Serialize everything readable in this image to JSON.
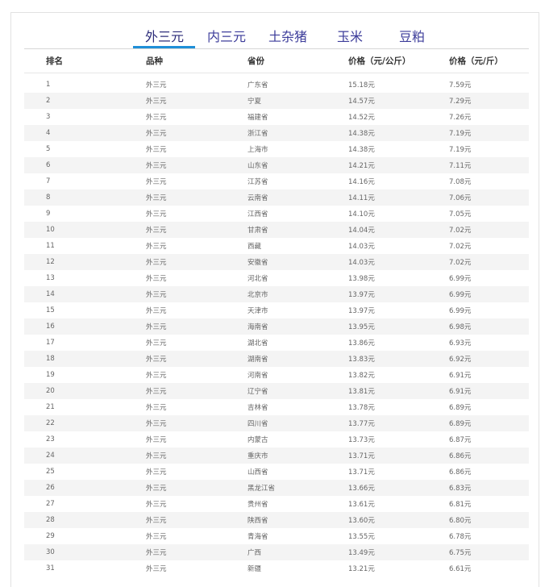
{
  "tabs": [
    {
      "label": "外三元",
      "active": true
    },
    {
      "label": "内三元",
      "active": false
    },
    {
      "label": "土杂猪",
      "active": false
    },
    {
      "label": "玉米",
      "active": false
    },
    {
      "label": "豆粕",
      "active": false
    }
  ],
  "table": {
    "headers": [
      "排名",
      "品种",
      "省份",
      "价格（元/公斤）",
      "价格（元/斤）"
    ],
    "rows": [
      [
        "1",
        "外三元",
        "广东省",
        "15.18元",
        "7.59元"
      ],
      [
        "2",
        "外三元",
        "宁夏",
        "14.57元",
        "7.29元"
      ],
      [
        "3",
        "外三元",
        "福建省",
        "14.52元",
        "7.26元"
      ],
      [
        "4",
        "外三元",
        "浙江省",
        "14.38元",
        "7.19元"
      ],
      [
        "5",
        "外三元",
        "上海市",
        "14.38元",
        "7.19元"
      ],
      [
        "6",
        "外三元",
        "山东省",
        "14.21元",
        "7.11元"
      ],
      [
        "7",
        "外三元",
        "江苏省",
        "14.16元",
        "7.08元"
      ],
      [
        "8",
        "外三元",
        "云南省",
        "14.11元",
        "7.06元"
      ],
      [
        "9",
        "外三元",
        "江西省",
        "14.10元",
        "7.05元"
      ],
      [
        "10",
        "外三元",
        "甘肃省",
        "14.04元",
        "7.02元"
      ],
      [
        "11",
        "外三元",
        "西藏",
        "14.03元",
        "7.02元"
      ],
      [
        "12",
        "外三元",
        "安徽省",
        "14.03元",
        "7.02元"
      ],
      [
        "13",
        "外三元",
        "河北省",
        "13.98元",
        "6.99元"
      ],
      [
        "14",
        "外三元",
        "北京市",
        "13.97元",
        "6.99元"
      ],
      [
        "15",
        "外三元",
        "天津市",
        "13.97元",
        "6.99元"
      ],
      [
        "16",
        "外三元",
        "海南省",
        "13.95元",
        "6.98元"
      ],
      [
        "17",
        "外三元",
        "湖北省",
        "13.86元",
        "6.93元"
      ],
      [
        "18",
        "外三元",
        "湖南省",
        "13.83元",
        "6.92元"
      ],
      [
        "19",
        "外三元",
        "河南省",
        "13.82元",
        "6.91元"
      ],
      [
        "20",
        "外三元",
        "辽宁省",
        "13.81元",
        "6.91元"
      ],
      [
        "21",
        "外三元",
        "吉林省",
        "13.78元",
        "6.89元"
      ],
      [
        "22",
        "外三元",
        "四川省",
        "13.77元",
        "6.89元"
      ],
      [
        "23",
        "外三元",
        "内蒙古",
        "13.73元",
        "6.87元"
      ],
      [
        "24",
        "外三元",
        "重庆市",
        "13.71元",
        "6.86元"
      ],
      [
        "25",
        "外三元",
        "山西省",
        "13.71元",
        "6.86元"
      ],
      [
        "26",
        "外三元",
        "黑龙江省",
        "13.66元",
        "6.83元"
      ],
      [
        "27",
        "外三元",
        "贵州省",
        "13.61元",
        "6.81元"
      ],
      [
        "28",
        "外三元",
        "陕西省",
        "13.60元",
        "6.80元"
      ],
      [
        "29",
        "外三元",
        "青海省",
        "13.55元",
        "6.78元"
      ],
      [
        "30",
        "外三元",
        "广西",
        "13.49元",
        "6.75元"
      ],
      [
        "31",
        "外三元",
        "新疆",
        "13.21元",
        "6.61元"
      ]
    ]
  }
}
